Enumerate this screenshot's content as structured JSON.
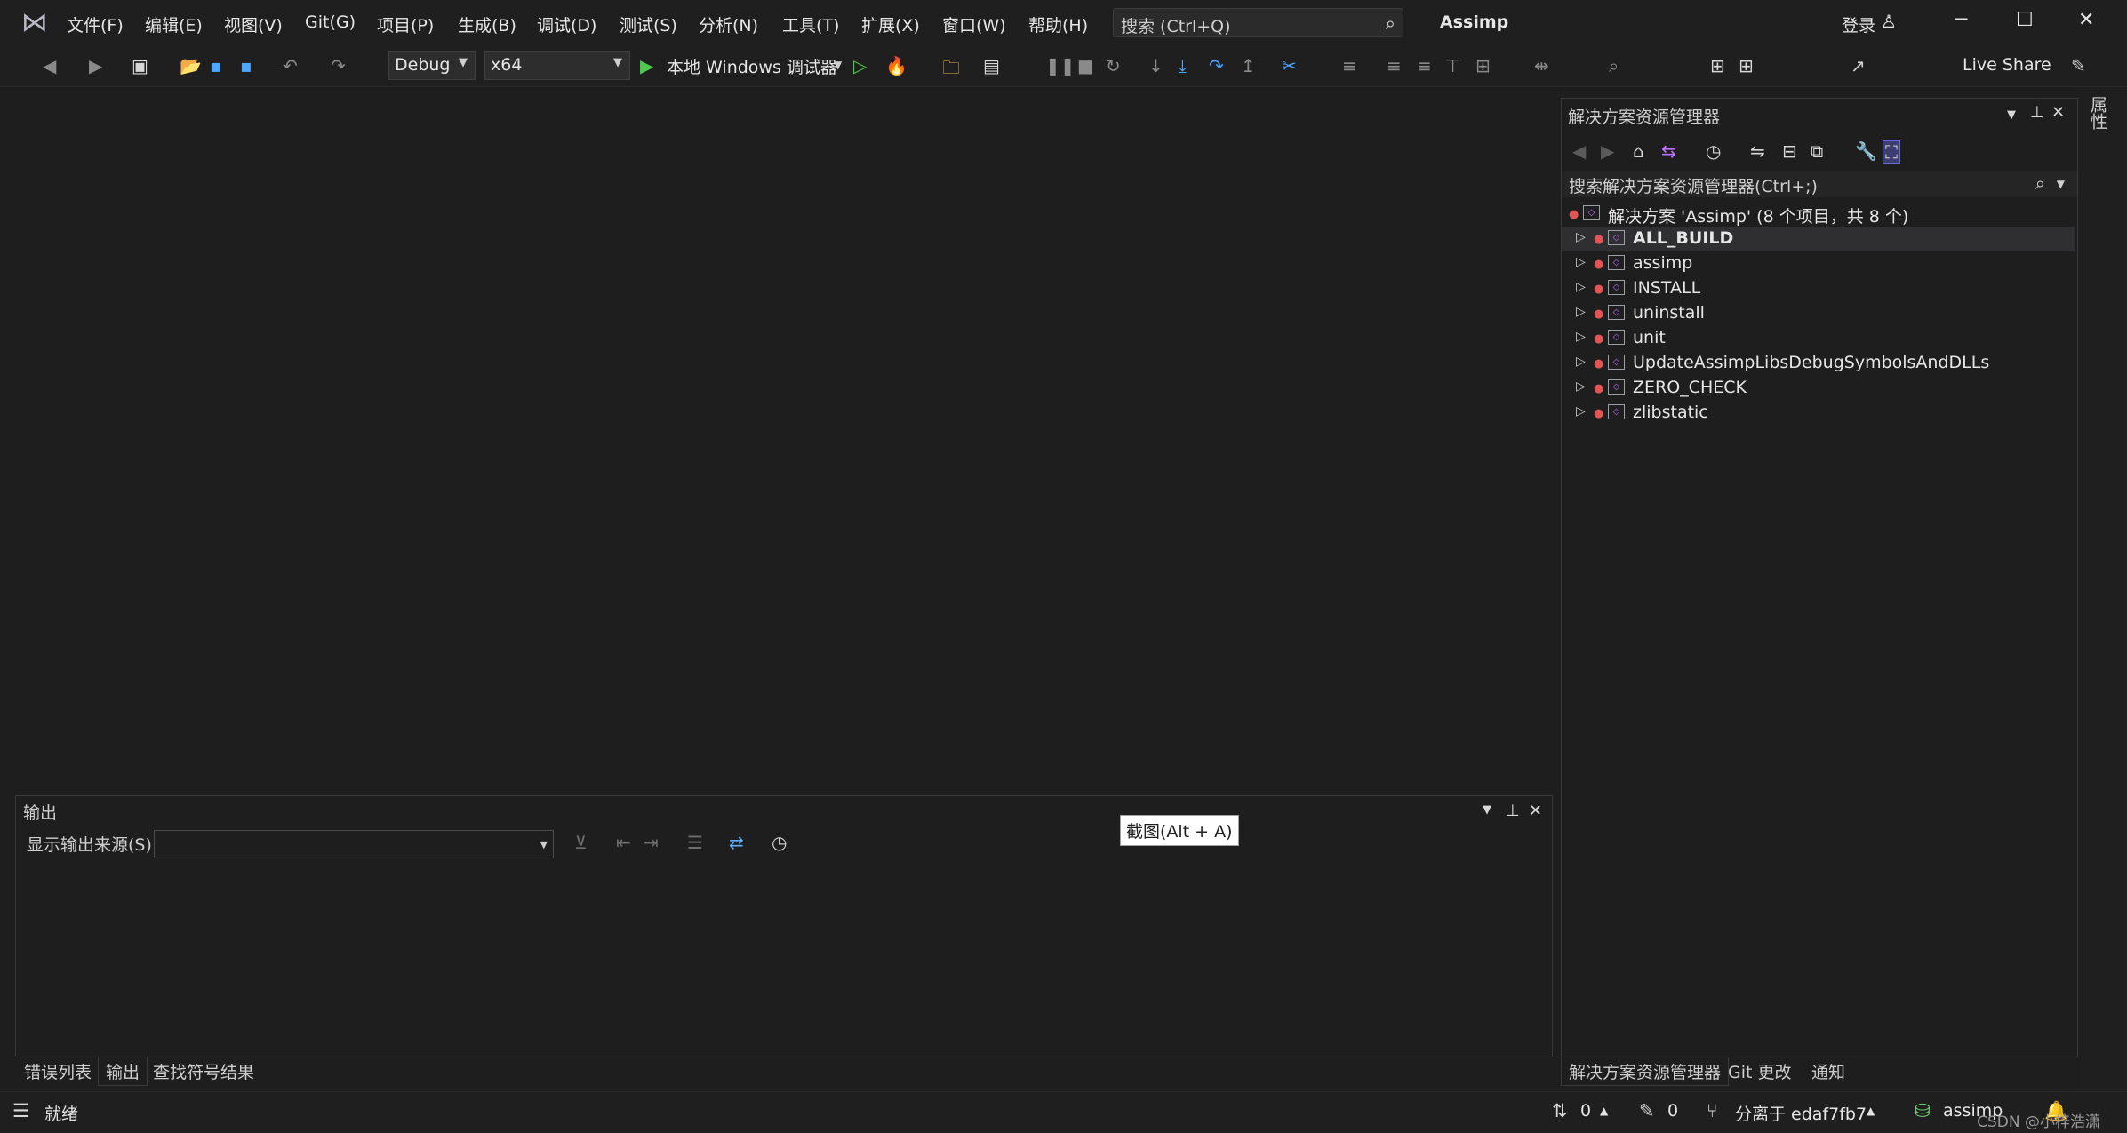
{
  "menu": {
    "items": [
      "文件(F)",
      "编辑(E)",
      "视图(V)",
      "Git(G)",
      "项目(P)",
      "生成(B)",
      "调试(D)",
      "测试(S)",
      "分析(N)",
      "工具(T)",
      "扩展(X)",
      "窗口(W)",
      "帮助(H)"
    ]
  },
  "titlebar": {
    "search_placeholder": "搜索 (Ctrl+Q)",
    "title": "Assimp",
    "login": "登录"
  },
  "toolbar": {
    "config": "Debug",
    "platform": "x64",
    "run_label": "本地 Windows 调试器",
    "live_share": "Live Share"
  },
  "output": {
    "title": "输出",
    "source_label": "显示输出来源(S):",
    "source_value": ""
  },
  "tooltip": "截图(Alt + A)",
  "bottom_tabs": [
    "错误列表",
    "输出",
    "查找符号结果"
  ],
  "solution_explorer": {
    "title": "解决方案资源管理器",
    "search_placeholder": "搜索解决方案资源管理器(Ctrl+;)",
    "solution": "解决方案 'Assimp' (8 个项目，共 8 个)",
    "projects": [
      "ALL_BUILD",
      "assimp",
      "INSTALL",
      "uninstall",
      "unit",
      "UpdateAssimpLibsDebugSymbolsAndDLLs",
      "ZERO_CHECK",
      "zlibstatic"
    ]
  },
  "se_tabs": [
    "解决方案资源管理器",
    "Git 更改",
    "通知"
  ],
  "right_strip": {
    "properties": "属性"
  },
  "statusbar": {
    "ready": "就绪",
    "up_down": "0",
    "pending": "0",
    "branch": "分离于 edaf7fb7",
    "repo": "assimp",
    "watermark": "CSDN @小梓浩潇"
  },
  "colors": {
    "background": "#1e1e1e",
    "chrome": "#1f1f1f",
    "accent_green": "#4ec94e",
    "accent_blue": "#4fa6ff",
    "error_red": "#e05555"
  }
}
